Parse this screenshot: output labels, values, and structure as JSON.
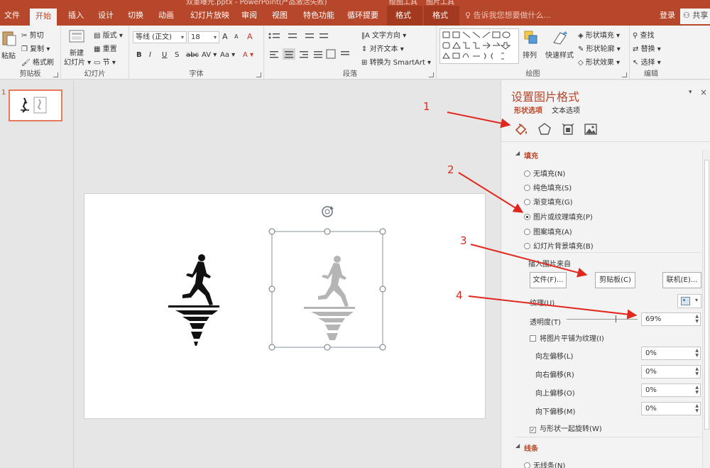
{
  "window": {
    "title_fragment": "双重曝光.pptx - PowerPoint(产品激活失败)",
    "context_group_1": "绘图工具",
    "context_group_2": "图片工具"
  },
  "tabs": [
    {
      "label": "文件"
    },
    {
      "label": "开始"
    },
    {
      "label": "插入"
    },
    {
      "label": "设计"
    },
    {
      "label": "切换"
    },
    {
      "label": "动画"
    },
    {
      "label": "幻灯片放映"
    },
    {
      "label": "审阅"
    },
    {
      "label": "视图"
    },
    {
      "label": "特色功能"
    },
    {
      "label": "循环提要"
    },
    {
      "label": "格式"
    },
    {
      "label": "格式"
    }
  ],
  "tell_me": "♀ 告诉我您想要做什么...",
  "login": "登录",
  "share": "共享",
  "ribbon": {
    "clipboard": {
      "label": "剪贴板",
      "paste": "粘贴",
      "cut": "剪切",
      "copy": "复制 ▾",
      "painter": "格式刷"
    },
    "slides": {
      "label": "幻灯片",
      "new_slide": "新建",
      "new_slide2": "幻灯片 ▾",
      "layout": "版式 ▾",
      "reset": "重置",
      "section": "节 ▾"
    },
    "font": {
      "label": "字体",
      "font_name": "等线 (正文)",
      "font_size": "18",
      "grow": "A",
      "shrink": "A",
      "clear": "A",
      "bold": "B",
      "italic": "I",
      "underline": "U",
      "shadow": "S",
      "strike": "abc",
      "spacing": "AV ▾",
      "case": "Aa ▾",
      "color": "A ▾"
    },
    "paragraph": {
      "label": "段落",
      "text_dir": "文字方向 ▾",
      "align_text": "对齐文本 ▾",
      "smartart": "转换为 SmartArt ▾"
    },
    "drawing": {
      "label": "绘图",
      "arrange": "排列",
      "quick_styles": "快速样式",
      "fill": "形状填充 ▾",
      "outline": "形状轮廓 ▾",
      "effects": "形状效果 ▾"
    },
    "editing": {
      "label": "编辑",
      "find": "查找",
      "replace": "替换 ▾",
      "select": "选择 ▾"
    }
  },
  "thumbnail": {
    "number": "1"
  },
  "pane": {
    "title": "设置图片格式",
    "subtab_shape": "形状选项",
    "subtab_text": "文本选项",
    "fill_section": "填充",
    "fill_options": [
      {
        "label": "无填充(N)",
        "selected": false
      },
      {
        "label": "纯色填充(S)",
        "selected": false
      },
      {
        "label": "渐变填充(G)",
        "selected": false
      },
      {
        "label": "图片或纹理填充(P)",
        "selected": true
      },
      {
        "label": "图案填充(A)",
        "selected": false
      },
      {
        "label": "幻灯片背景填充(B)",
        "selected": false
      }
    ],
    "insert_from": "插入图片来自",
    "btn_file": "文件(F)...",
    "btn_clipboard": "剪贴板(C)",
    "btn_online": "联机(E)...",
    "texture_label": "纹理(U)",
    "transparency_label": "透明度(T)",
    "transparency_value": "69%",
    "transparency_fraction": 0.69,
    "tile_label": "将图片平铺为纹理(I)",
    "offset_left_label": "向左偏移(L)",
    "offset_left_value": "0%",
    "offset_right_label": "向右偏移(R)",
    "offset_right_value": "0%",
    "offset_top_label": "向上偏移(O)",
    "offset_top_value": "0%",
    "offset_bottom_label": "向下偏移(M)",
    "offset_bottom_value": "0%",
    "rotate_label": "与形状一起旋转(W)",
    "line_section": "线条",
    "no_line": "无线条(N)"
  },
  "annotations": [
    "1",
    "2",
    "3",
    "4"
  ],
  "colors": {
    "accent": "#b7472a",
    "annotation": "#e0281e"
  }
}
